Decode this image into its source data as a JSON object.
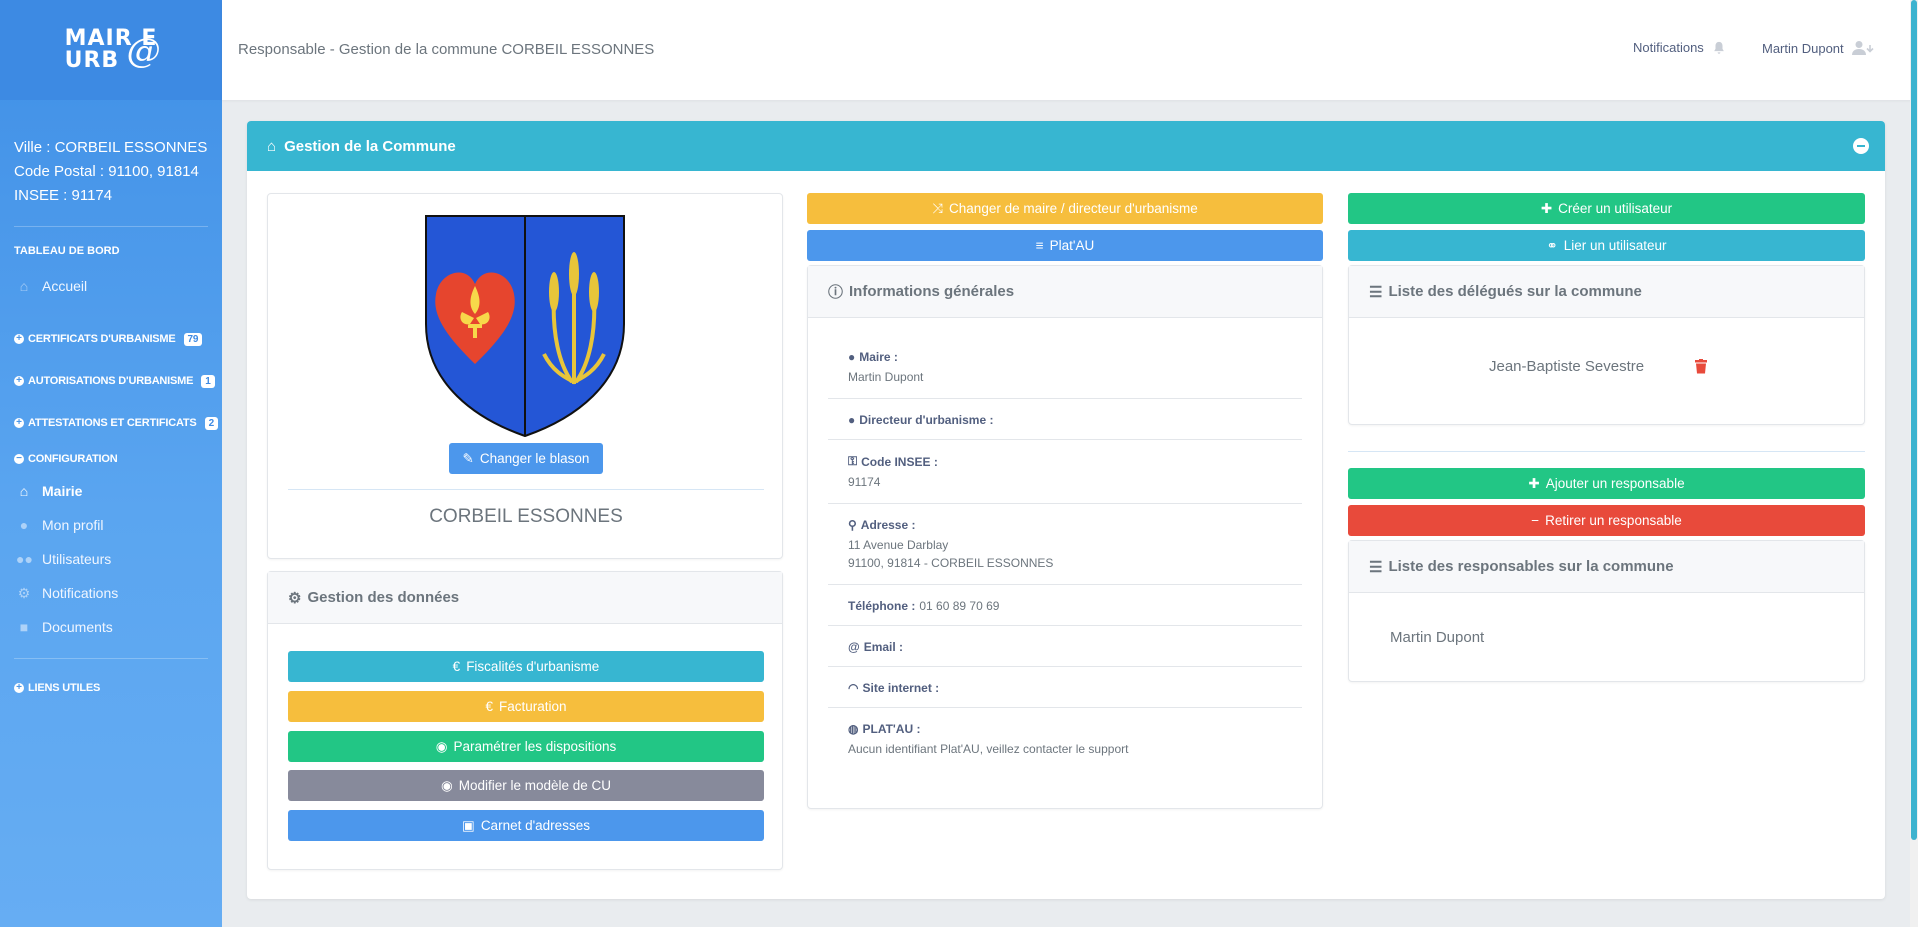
{
  "logo": {
    "line1": "MAIR E",
    "line2": "URB",
    "at": "@"
  },
  "sidebar": {
    "city": "Ville : CORBEIL ESSONNES",
    "postal": "Code Postal : 91100, 91814",
    "insee": "INSEE : 91174",
    "dashboard_title": "TABLEAU DE BORD",
    "home": "Accueil",
    "sections": [
      {
        "label": "CERTIFICATS D'URBANISME",
        "badge": "79"
      },
      {
        "label": "AUTORISATIONS D'URBANISME",
        "badge": "1"
      },
      {
        "label": "ATTESTATIONS ET CERTIFICATS",
        "badge": "2"
      }
    ],
    "config_title": "CONFIGURATION",
    "config_items": [
      "Mairie",
      "Mon profil",
      "Utilisateurs",
      "Notifications",
      "Documents"
    ],
    "links_title": "LIENS UTILES"
  },
  "header": {
    "title": "Responsable - Gestion de la commune CORBEIL ESSONNES",
    "notifications": "Notifications",
    "user": "Martin Dupont"
  },
  "main": {
    "title": "Gestion de la Commune",
    "commune_name": "CORBEIL ESSONNES",
    "change_blason": "Changer le blason",
    "data_panel_title": "Gestion des données",
    "data_buttons": [
      "Fiscalités d'urbanisme",
      "Facturation",
      "Paramétrer les dispositions",
      "Modifier le modèle de CU",
      "Carnet d'adresses"
    ],
    "change_mayor": "Changer de maire / directeur d'urbanisme",
    "platau_btn": "Plat'AU",
    "info_title": "Informations générales",
    "info": {
      "maire_label": "Maire :",
      "maire_value": "Martin Dupont",
      "directeur_label": "Directeur d'urbanisme :",
      "insee_label": "Code INSEE :",
      "insee_value": "91174",
      "adresse_label": "Adresse :",
      "adresse_line1": "11 Avenue Darblay",
      "adresse_line2": "91100, 91814 - CORBEIL ESSONNES",
      "tel_label": "Téléphone :",
      "tel_value": "01 60 89 70 69",
      "email_label": "Email :",
      "site_label": "Site internet :",
      "platau_label": "PLAT'AU :",
      "platau_value": "Aucun identifiant Plat'AU, veillez contacter le support"
    },
    "create_user": "Créer un utilisateur",
    "link_user": "Lier un utilisateur",
    "delegates_title": "Liste des délégués sur la commune",
    "delegate_name": "Jean-Baptiste Sevestre",
    "add_responsible": "Ajouter un responsable",
    "remove_responsible": "Retirer un responsable",
    "responsibles_title": "Liste des responsables sur la commune",
    "responsible_name": "Martin Dupont"
  },
  "colors": {
    "accent": "#37b6d1",
    "sidebar": "#4a96e8",
    "yellow": "#f6be3d",
    "green": "#22c685",
    "red": "#e84a3b",
    "blue": "#4c97ec",
    "gray": "#878a9b"
  }
}
